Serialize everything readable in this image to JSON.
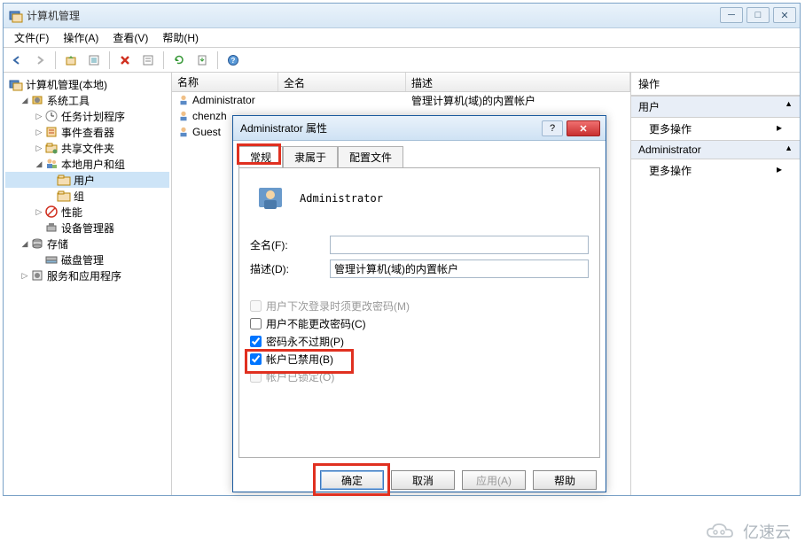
{
  "window": {
    "title": "计算机管理",
    "menu": {
      "file": "文件(F)",
      "action": "操作(A)",
      "view": "查看(V)",
      "help": "帮助(H)"
    }
  },
  "tree": {
    "root": "计算机管理(本地)",
    "systools": "系统工具",
    "sched": "任务计划程序",
    "eventvwr": "事件查看器",
    "shared": "共享文件夹",
    "localusers": "本地用户和组",
    "users": "用户",
    "groups": "组",
    "perf": "性能",
    "devmgr": "设备管理器",
    "storage": "存储",
    "diskmgmt": "磁盘管理",
    "services": "服务和应用程序"
  },
  "list": {
    "hdr_name": "名称",
    "hdr_fullname": "全名",
    "hdr_desc": "描述",
    "rows": [
      {
        "name": "Administrator",
        "full": "",
        "desc": "管理计算机(域)的内置帐户"
      },
      {
        "name": "chenzh",
        "full": "",
        "desc": ""
      },
      {
        "name": "Guest",
        "full": "",
        "desc": ""
      }
    ]
  },
  "actions": {
    "title": "操作",
    "section_users": "用户",
    "more": "更多操作",
    "section_admin": "Administrator"
  },
  "dialog": {
    "title": "Administrator 属性",
    "tabs": {
      "general": "常规",
      "memberof": "隶属于",
      "profile": "配置文件"
    },
    "username": "Administrator",
    "fullname_label": "全名(F):",
    "fullname_value": "",
    "desc_label": "描述(D):",
    "desc_value": "管理计算机(域)的内置帐户",
    "chk_mustchange": "用户下次登录时须更改密码(M)",
    "chk_cannotchange": "用户不能更改密码(C)",
    "chk_neverexpire": "密码永不过期(P)",
    "chk_disabled": "帐户已禁用(B)",
    "chk_locked": "帐户已锁定(O)",
    "btn_ok": "确定",
    "btn_cancel": "取消",
    "btn_apply": "应用(A)",
    "btn_help": "帮助"
  },
  "watermark": "亿速云"
}
